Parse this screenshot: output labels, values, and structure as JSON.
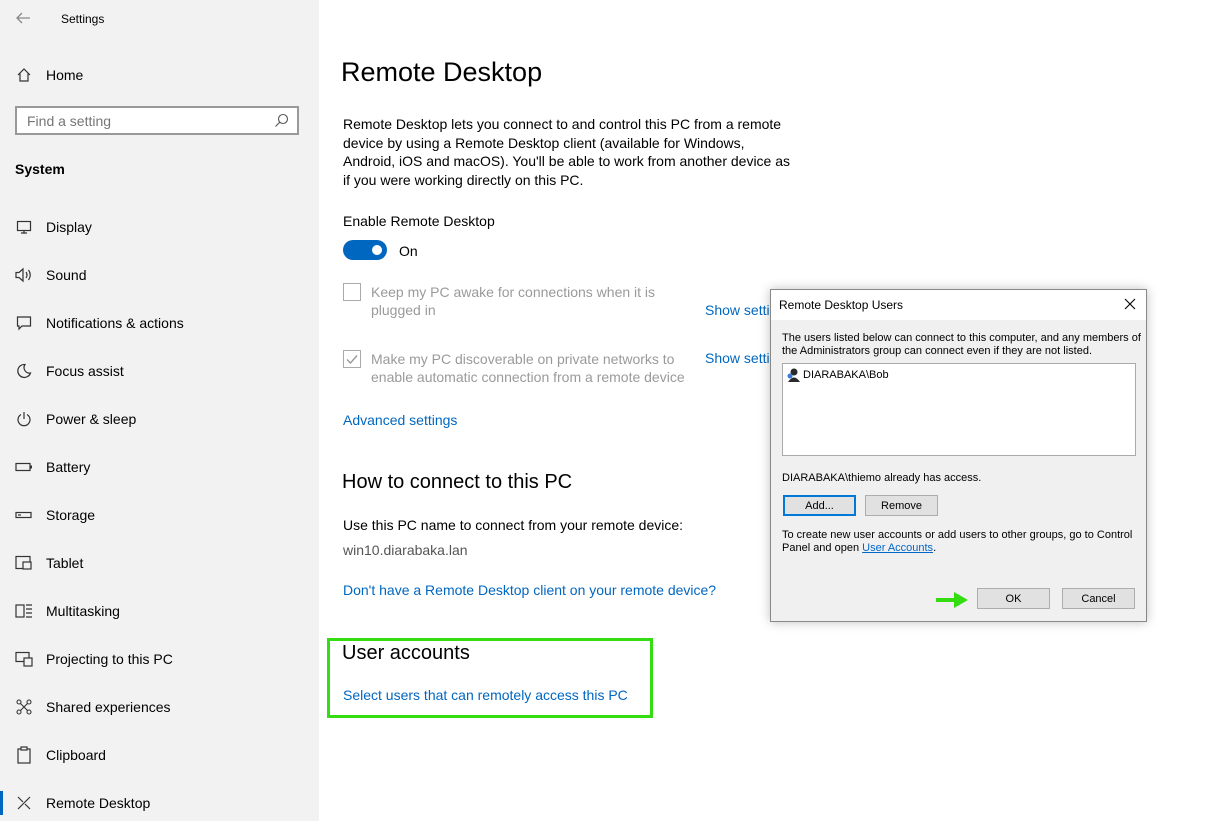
{
  "app": {
    "title": "Settings"
  },
  "sidebar": {
    "home_label": "Home",
    "search_placeholder": "Find a setting",
    "section_label": "System",
    "items": [
      {
        "label": "Display",
        "icon": "monitor-icon"
      },
      {
        "label": "Sound",
        "icon": "speaker-icon"
      },
      {
        "label": "Notifications & actions",
        "icon": "notification-icon"
      },
      {
        "label": "Focus assist",
        "icon": "moon-icon"
      },
      {
        "label": "Power & sleep",
        "icon": "power-icon"
      },
      {
        "label": "Battery",
        "icon": "battery-icon"
      },
      {
        "label": "Storage",
        "icon": "storage-icon"
      },
      {
        "label": "Tablet",
        "icon": "tablet-icon"
      },
      {
        "label": "Multitasking",
        "icon": "multitasking-icon"
      },
      {
        "label": "Projecting to this PC",
        "icon": "projecting-icon"
      },
      {
        "label": "Shared experiences",
        "icon": "shared-icon"
      },
      {
        "label": "Clipboard",
        "icon": "clipboard-icon"
      },
      {
        "label": "Remote Desktop",
        "icon": "remote-desktop-icon",
        "active": true
      }
    ]
  },
  "main": {
    "title": "Remote Desktop",
    "description": "Remote Desktop lets you connect to and control this PC from a remote device by using a Remote Desktop client (available for Windows, Android, iOS and macOS). You'll be able to work from another device as if you were working directly on this PC.",
    "enable_label": "Enable Remote Desktop",
    "toggle_state": "On",
    "options": [
      {
        "text": "Keep my PC awake for connections when it is plugged in",
        "checked": false,
        "link": "Show setti"
      },
      {
        "text": "Make my PC discoverable on private networks to enable automatic connection from a remote device",
        "checked": true,
        "link": "Show setti"
      }
    ],
    "advanced_link": "Advanced settings",
    "connect_heading": "How to connect to this PC",
    "pc_name_label": "Use this PC name to connect from your remote device:",
    "pc_name": "win10.diarabaka.lan",
    "client_link": "Don't have a Remote Desktop client on your remote device?",
    "users_heading": "User accounts",
    "users_link": "Select users that can remotely access this PC"
  },
  "dialog": {
    "title": "Remote Desktop Users",
    "info": "The users listed below can connect to this computer, and any members of the Administrators group can connect even if they are not listed.",
    "users": [
      "DIARABAKA\\Bob"
    ],
    "access_note": "DIARABAKA\\thiemo already has access.",
    "add_label": "Add...",
    "remove_label": "Remove",
    "help_prefix": "To create new user accounts or add users to other groups, go to Control Panel and open ",
    "help_link": "User Accounts",
    "help_suffix": ".",
    "ok_label": "OK",
    "cancel_label": "Cancel"
  },
  "colors": {
    "accent": "#0067c0",
    "highlight": "#33dd11",
    "sidebar_bg": "#f2f2f2"
  }
}
